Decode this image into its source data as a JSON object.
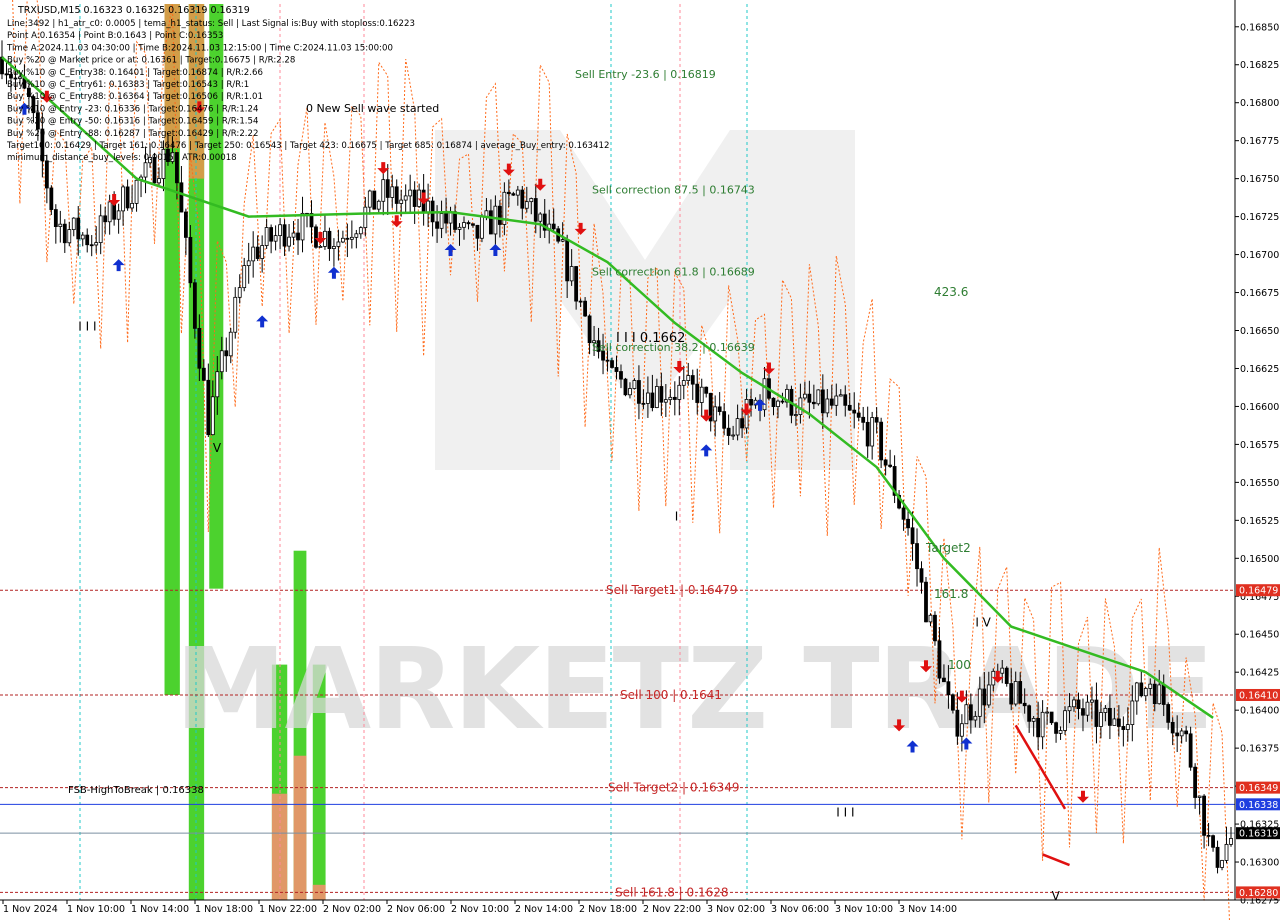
{
  "header": {
    "title": "TRXUSD,M15  0.16323 0.16325 0.16319 0.16319",
    "info_lines": [
      "Line:3492 | h1_atr_c0: 0.0005 | tema_h1_status: Sell | Last Signal is:Buy with stoploss:0.16223",
      "Point A:0.16354 | Point B:0.1643 | Point C:0.16353",
      "Time A:2024.11.03 04:30:00 | Time B:2024.11.03 12:15:00 | Time C:2024.11.03 15:00:00",
      "Buy %20 @ Market price or at: 0.16361 | Target:0.16675 | R/R:2.28",
      "Buy %10 @ C_Entry38: 0.16401 | Target:0.16874 | R/R:2.66",
      "Buy %10 @ C_Entry61: 0.16383 | Target:0.16543 | R/R:1",
      "Buy %10 @ C_Entry88: 0.16364 | Target:0.16506 | R/R:1.01",
      "Buy %10 @ Entry -23: 0.16336 | Target:0.16476 | R/R:1.24",
      "Buy %20 @ Entry -50: 0.16316 | Target:0.16459 | R/R:1.54",
      "Buy %20 @ Entry -88: 0.16287 | Target:0.16429 | R/R:2.22",
      "Target100: 0.16429 | Target 161: 0.16476 | Target 250: 0.16543 | Target 423: 0.16675 | Target 685: 0.16874 | average_Buy_entry: 0.163412",
      "minimum_distance_buy_levels: 0.0015 | ATR:0.00018"
    ]
  },
  "watermark": {
    "text": "MARKETZ TRADE"
  },
  "chart_data": {
    "type": "candlestick",
    "symbol": "TRXUSD",
    "timeframe": "M15",
    "ylim": [
      0.16275,
      0.16865
    ],
    "y_ticks": [
      "0.16850",
      "0.16825",
      "0.16800",
      "0.16775",
      "0.16750",
      "0.16725",
      "0.16700",
      "0.16675",
      "0.16650",
      "0.16625",
      "0.16600",
      "0.16575",
      "0.16550",
      "0.16525",
      "0.16500",
      "0.16475",
      "0.16450",
      "0.16425",
      "0.16400",
      "0.16375",
      "0.16350",
      "0.16325",
      "0.16300",
      "0.16275"
    ],
    "x_ticks": [
      "1 Nov 2024",
      "1 Nov 10:00",
      "1 Nov 14:00",
      "1 Nov 18:00",
      "1 Nov 22:00",
      "2 Nov 02:00",
      "2 Nov 06:00",
      "2 Nov 10:00",
      "2 Nov 14:00",
      "2 Nov 18:00",
      "2 Nov 22:00",
      "3 Nov 02:00",
      "3 Nov 06:00",
      "3 Nov 10:00",
      "3 Nov 14:00"
    ],
    "price_markers": [
      {
        "value": 0.16479,
        "label": "0.16479",
        "color": "#e03020"
      },
      {
        "value": 0.1641,
        "label": "0.16410",
        "color": "#e03020"
      },
      {
        "value": 0.16349,
        "label": "0.16349",
        "color": "#e03020"
      },
      {
        "value": 0.16338,
        "label": "0.16338",
        "color": "#1f3fe0"
      },
      {
        "value": 0.16319,
        "label": "0.16319",
        "color": "#000000"
      },
      {
        "value": 0.1628,
        "label": "0.16280",
        "color": "#e03020"
      }
    ],
    "horizontal_lines": [
      {
        "value": 0.16479,
        "style": "dashed",
        "color": "#b22222"
      },
      {
        "value": 0.1641,
        "style": "dashed",
        "color": "#b22222"
      },
      {
        "value": 0.16349,
        "style": "dashed",
        "color": "#b22222"
      },
      {
        "value": 0.16338,
        "style": "solid",
        "color": "#1f3fe0"
      },
      {
        "value": 0.16319,
        "style": "solid",
        "color": "#7a8fa0"
      },
      {
        "value": 0.1628,
        "style": "dashed",
        "color": "#b22222"
      }
    ],
    "level_labels": [
      {
        "text": "Sell Entry -23.6 | 0.16819",
        "value": 0.16819,
        "color": "#2e7d32"
      },
      {
        "text": "Sell correction 87.5 | 0.16743",
        "value": 0.16743,
        "color": "#2e7d32"
      },
      {
        "text": "Sell correction 61.8 | 0.16689",
        "value": 0.16689,
        "color": "#2e7d32"
      },
      {
        "text": "Sell correction 38.2 | 0.16639",
        "value": 0.16639,
        "color": "#2e7d32"
      },
      {
        "text": "Sell Target1 | 0.16479",
        "value": 0.16479,
        "color": "#c62828"
      },
      {
        "text": "Sell 100 | 0.1641",
        "value": 0.1641,
        "color": "#c62828"
      },
      {
        "text": "Sell Target2 | 0.16349",
        "value": 0.16349,
        "color": "#c62828"
      },
      {
        "text": "Sell 161.8 | 0.1628",
        "value": 0.1628,
        "color": "#c62828"
      }
    ],
    "annotations": [
      {
        "text": "0 New Sell wave started",
        "color": "#000000"
      },
      {
        "text": "I I I 0.1662",
        "color": "#000000"
      },
      {
        "text": "423.6",
        "color": "#2e7d32"
      },
      {
        "text": "Target2",
        "color": "#2e7d32"
      },
      {
        "text": "161.8",
        "color": "#2e7d32"
      },
      {
        "text": "100",
        "color": "#2e7d32"
      },
      {
        "text": "FSB-HighToBreak | 0.16338",
        "color": "#000000"
      }
    ],
    "zones": [
      {
        "x_range": [
          0.16,
          0.172
        ],
        "y_range": [
          0.1641,
          0.16865
        ],
        "color": "#33cc11",
        "top_band": [
          0.1677,
          0.16865
        ],
        "top_band_color": "#d99a4a"
      },
      {
        "x_range": [
          0.179,
          0.191
        ],
        "y_range": [
          0.16275,
          0.16865
        ],
        "color": "#33cc11",
        "top_band": [
          0.1675,
          0.16865
        ],
        "top_band_color": "#d99a4a"
      },
      {
        "x_range": [
          0.195,
          0.206
        ],
        "y_range": [
          0.1648,
          0.16865
        ],
        "color": "#33cc11"
      },
      {
        "x_range": [
          0.244,
          0.256
        ],
        "y_range": [
          0.16275,
          0.1643
        ],
        "color": "#33cc11",
        "bottom_band": [
          0.16275,
          0.16345
        ],
        "bottom_band_color": "#e8956a"
      },
      {
        "x_range": [
          0.261,
          0.271
        ],
        "y_range": [
          0.16275,
          0.16505
        ],
        "color": "#33cc11",
        "bottom_band": [
          0.16275,
          0.1637
        ],
        "bottom_band_color": "#e8956a"
      },
      {
        "x_range": [
          0.276,
          0.286
        ],
        "y_range": [
          0.16275,
          0.1643
        ],
        "color": "#33cc11",
        "bottom_band": [
          0.16275,
          0.16285
        ],
        "bottom_band_color": "#e8956a"
      }
    ],
    "candles": {
      "count": 275,
      "trend_path": [
        [
          0,
          0.1683
        ],
        [
          6,
          0.168
        ],
        [
          12,
          0.1672
        ],
        [
          20,
          0.1671
        ],
        [
          28,
          0.1674
        ],
        [
          38,
          0.1677
        ],
        [
          46,
          0.1659
        ],
        [
          55,
          0.167
        ],
        [
          65,
          0.1672
        ],
        [
          75,
          0.1671
        ],
        [
          85,
          0.1674
        ],
        [
          95,
          0.1673
        ],
        [
          105,
          0.1671
        ],
        [
          115,
          0.1674
        ],
        [
          125,
          0.167
        ],
        [
          135,
          0.1662
        ],
        [
          145,
          0.1661
        ],
        [
          155,
          0.1661
        ],
        [
          162,
          0.1658
        ],
        [
          170,
          0.1661
        ],
        [
          178,
          0.166
        ],
        [
          186,
          0.166
        ],
        [
          195,
          0.1658
        ],
        [
          202,
          0.1652
        ],
        [
          212,
          0.1639
        ],
        [
          222,
          0.1642
        ],
        [
          232,
          0.1639
        ],
        [
          240,
          0.164
        ],
        [
          248,
          0.1639
        ],
        [
          256,
          0.1642
        ],
        [
          264,
          0.1638
        ],
        [
          270,
          0.163
        ],
        [
          275,
          0.16319
        ]
      ],
      "seed": 7
    },
    "ema": [
      [
        0,
        0.1683
      ],
      [
        30,
        0.1675
      ],
      [
        55,
        0.16725
      ],
      [
        80,
        0.16727
      ],
      [
        100,
        0.16728
      ],
      [
        120,
        0.1672
      ],
      [
        135,
        0.16695
      ],
      [
        150,
        0.16655
      ],
      [
        165,
        0.16622
      ],
      [
        180,
        0.16595
      ],
      [
        195,
        0.1656
      ],
      [
        210,
        0.165
      ],
      [
        225,
        0.16455
      ],
      [
        240,
        0.1644
      ],
      [
        255,
        0.16425
      ],
      [
        270,
        0.16395
      ]
    ],
    "pivot_marks": [
      {
        "text": "V",
        "index": 47,
        "value": 0.1657
      },
      {
        "text": "I I I",
        "index": 17,
        "value": 0.1665
      },
      {
        "text": "I",
        "index": 150,
        "value": 0.16525
      },
      {
        "text": "I I I",
        "index": 186,
        "value": 0.1633
      },
      {
        "text": "I V",
        "index": 217,
        "value": 0.16455
      },
      {
        "text": "V",
        "index": 234,
        "value": 0.16275
      }
    ],
    "buy_arrows": [
      [
        5,
        0.168
      ],
      [
        26,
        0.16697
      ],
      [
        58,
        0.1666
      ],
      [
        74,
        0.16692
      ],
      [
        100,
        0.16707
      ],
      [
        110,
        0.16707
      ],
      [
        157,
        0.16575
      ],
      [
        169,
        0.16605
      ],
      [
        203,
        0.1638
      ],
      [
        215,
        0.16382
      ]
    ],
    "sell_arrows": [
      [
        10,
        0.168
      ],
      [
        25,
        0.16732
      ],
      [
        44,
        0.16793
      ],
      [
        71,
        0.16707
      ],
      [
        85,
        0.16753
      ],
      [
        88,
        0.16718
      ],
      [
        94,
        0.16733
      ],
      [
        113,
        0.16752
      ],
      [
        120,
        0.16742
      ],
      [
        129,
        0.16713
      ],
      [
        151,
        0.16622
      ],
      [
        157,
        0.1659
      ],
      [
        166,
        0.16594
      ],
      [
        171,
        0.16621
      ],
      [
        200,
        0.16386
      ],
      [
        206,
        0.16425
      ],
      [
        214,
        0.16405
      ],
      [
        222,
        0.16418
      ],
      [
        241,
        0.16339
      ]
    ],
    "rising_lines": [
      [
        [
          226,
          0.1639
        ],
        [
          237,
          0.16335
        ]
      ],
      [
        [
          232,
          0.16305
        ],
        [
          238,
          0.16298
        ]
      ]
    ]
  },
  "colors": {
    "background": "#ffffff",
    "bull_candle": "#000000",
    "bear_candle": "#000000",
    "ema": "#33bb22",
    "sell_arrow": "#e01010",
    "buy_arrow": "#1030d0",
    "orange_trail": "#ff6a1a",
    "watermark": "#d9d9d9"
  }
}
